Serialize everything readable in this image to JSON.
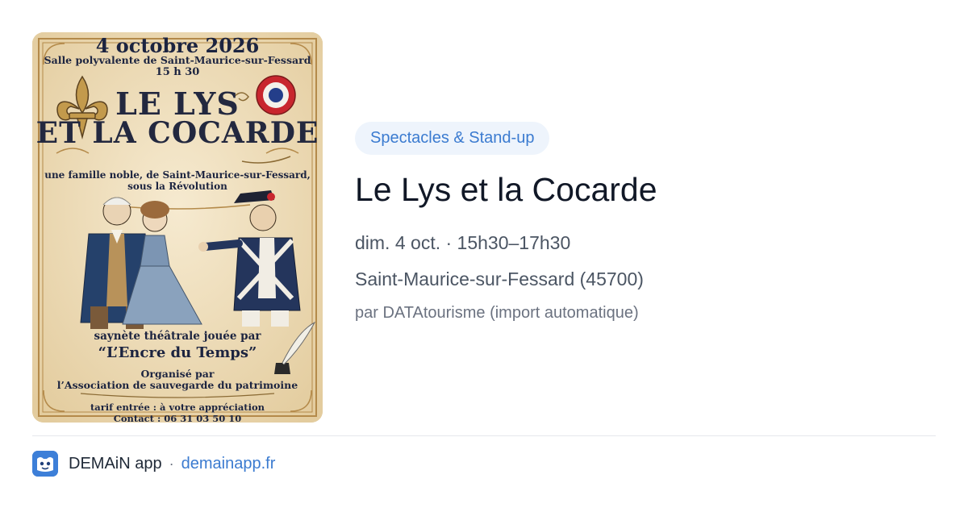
{
  "poster": {
    "date": "4 octobre 2026",
    "venue": "Salle polyvalente de Saint-Maurice-sur-Fessard",
    "time": "15 h 30",
    "title_line1": "LE LYS",
    "title_line2": "ET LA COCARDE",
    "subtitle_line1": "une famille noble, de Saint-Maurice-sur-Fessard,",
    "subtitle_line2": "sous la Révolution",
    "play_line": "saynète théâtrale jouée par",
    "troupe": "“L’Encre du Temps”",
    "organizer_label": "Organisé par",
    "organizer": "l’Association de sauvegarde du patrimoine",
    "tarif": "tarif entrée : à votre appréciation",
    "contact": "Contact : 06 31 03 50 10",
    "icons": [
      "fleur-de-lis-icon",
      "cocarde-icon",
      "quill-inkwell-icon"
    ]
  },
  "event": {
    "category": "Spectacles & Stand-up",
    "title": "Le Lys et la Cocarde",
    "when": "dim. 4 oct. · 15h30–17h30",
    "where": "Saint-Maurice-sur-Fessard (45700)",
    "source": "par DATAtourisme (import automatique)"
  },
  "footer": {
    "app_name": "DEMAiN app",
    "separator": "·",
    "link": "demainapp.fr"
  },
  "colors": {
    "accent": "#3b7bd0",
    "badge_bg": "#eef4fc",
    "poster_bg": "#f1e3c5"
  }
}
